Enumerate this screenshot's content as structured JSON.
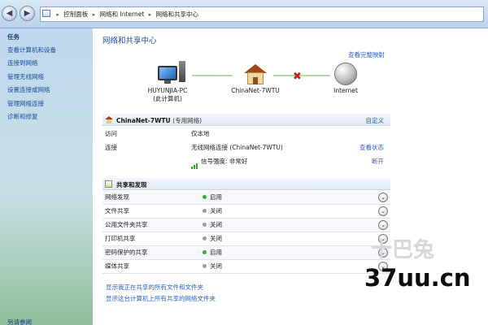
{
  "breadcrumb": {
    "items": [
      "控制面板",
      "网络和 Internet",
      "网络和共享中心"
    ]
  },
  "sidebar": {
    "title": "任务",
    "items": [
      {
        "label": "查看计算机和设备"
      },
      {
        "label": "连接到网络"
      },
      {
        "label": "管理无线网络"
      },
      {
        "label": "设置连接或网络"
      },
      {
        "label": "管理网络连接"
      },
      {
        "label": "诊断和修复"
      }
    ],
    "footer": "另请参阅"
  },
  "main": {
    "title": "网络和共享中心",
    "full_map_link": "查看完整映射",
    "map": {
      "computer_name": "HUYUNJIA-PC",
      "computer_sub": "(此计算机)",
      "network_name": "ChinaNet-7WTU",
      "internet": "Internet",
      "connection_status": "disconnected"
    },
    "network": {
      "name": "ChinaNet-7WTU",
      "type": "(专用网络)",
      "customize_link": "自定义",
      "rows": [
        {
          "label": "访问",
          "value": "仅本地",
          "link": ""
        },
        {
          "label": "连接",
          "value": "无线网络连接 (ChinaNet-7WTU)",
          "link": "查看状态"
        },
        {
          "label": "",
          "value": "信号强度: 非常好",
          "link": "断开"
        }
      ]
    },
    "sharing": {
      "title": "共享和发现",
      "rows": [
        {
          "label": "网络发现",
          "value": "启用",
          "status": "on"
        },
        {
          "label": "文件共享",
          "value": "关闭",
          "status": "off"
        },
        {
          "label": "公用文件夹共享",
          "value": "关闭",
          "status": "off"
        },
        {
          "label": "打印机共享",
          "value": "关闭",
          "status": "off"
        },
        {
          "label": "密码保护的共享",
          "value": "启用",
          "status": "on"
        },
        {
          "label": "媒体共享",
          "value": "关闭",
          "status": "off"
        }
      ]
    },
    "bottom_links": [
      "显示我正在共享的所有文件和文件夹",
      "显示这台计算机上所有共享的网络文件夹"
    ]
  },
  "watermark": {
    "text": "37uu.cn",
    "faint_text": "十巴兔"
  },
  "colors": {
    "link": "#2862b8",
    "status_on": "#2bb32b",
    "status_off": "#9a9a9a",
    "disconnected": "#d21c1c"
  }
}
